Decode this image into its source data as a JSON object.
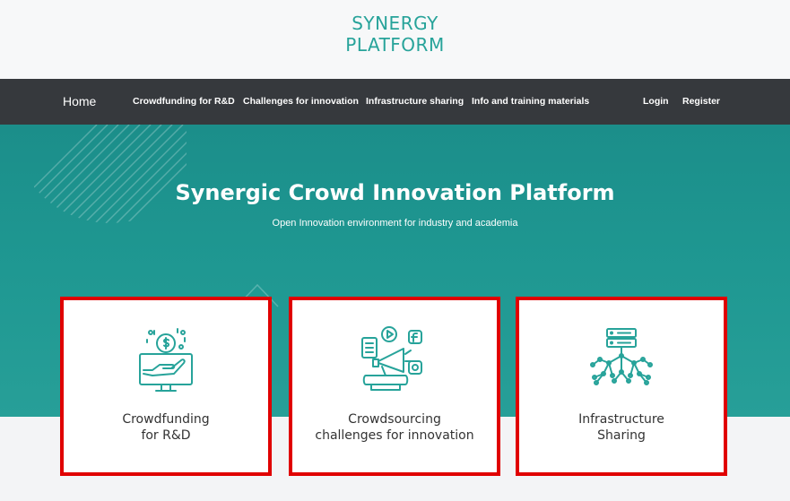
{
  "brand": {
    "line1": "SYNERGY",
    "line2": "PLATFORM"
  },
  "nav": {
    "home": "Home",
    "items": [
      "Crowdfunding for R&D",
      "Challenges for innovation",
      "Infrastructure sharing",
      "Info and training materials"
    ],
    "login": "Login",
    "register": "Register"
  },
  "hero": {
    "title": "Synergic Crowd Innovation Platform",
    "subtitle": "Open Innovation environment for industry and academia"
  },
  "cards": [
    {
      "line1": "Crowdfunding",
      "line2": "for R&D",
      "icon": "crowdfunding-icon"
    },
    {
      "line1": "Crowdsourcing",
      "line2": "challenges for innovation",
      "icon": "megaphone-social-icon"
    },
    {
      "line1": "Infrastructure",
      "line2": "Sharing",
      "icon": "server-network-icon"
    }
  ],
  "colors": {
    "accent": "#27a39a",
    "nav_bg": "#36393d",
    "highlight_border": "#e00000"
  }
}
